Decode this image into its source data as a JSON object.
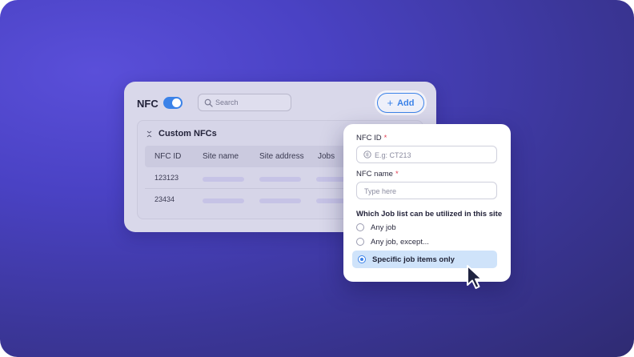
{
  "header": {
    "title": "NFC",
    "toggle_on": true,
    "search_placeholder": "Search",
    "add_label": "Add"
  },
  "table_section": {
    "title": "Custom NFCs",
    "columns": [
      "NFC ID",
      "Site name",
      "Site address",
      "Jobs"
    ],
    "rows": [
      {
        "nfc_id": "123123"
      },
      {
        "nfc_id": "23434"
      }
    ]
  },
  "form": {
    "nfc_id_label": "NFC ID",
    "nfc_id_required": "*",
    "nfc_id_placeholder": "E.g: CT213",
    "nfc_name_label": "NFC name",
    "nfc_name_required": "*",
    "nfc_name_placeholder": "Type here",
    "job_list_question": "Which Job list can be utilized in this site",
    "options": [
      {
        "label": "Any job",
        "selected": false
      },
      {
        "label": "Any job, except...",
        "selected": false
      },
      {
        "label": "Specific job items only",
        "selected": true
      }
    ]
  },
  "colors": {
    "accent": "#3b82e8",
    "required": "#e23b4e",
    "selected_bg": "#cfe3fa",
    "background": "#4a42c4"
  },
  "icons": [
    "search-icon",
    "plus-icon",
    "collapse-icon",
    "nfc-icon",
    "cursor-icon"
  ]
}
